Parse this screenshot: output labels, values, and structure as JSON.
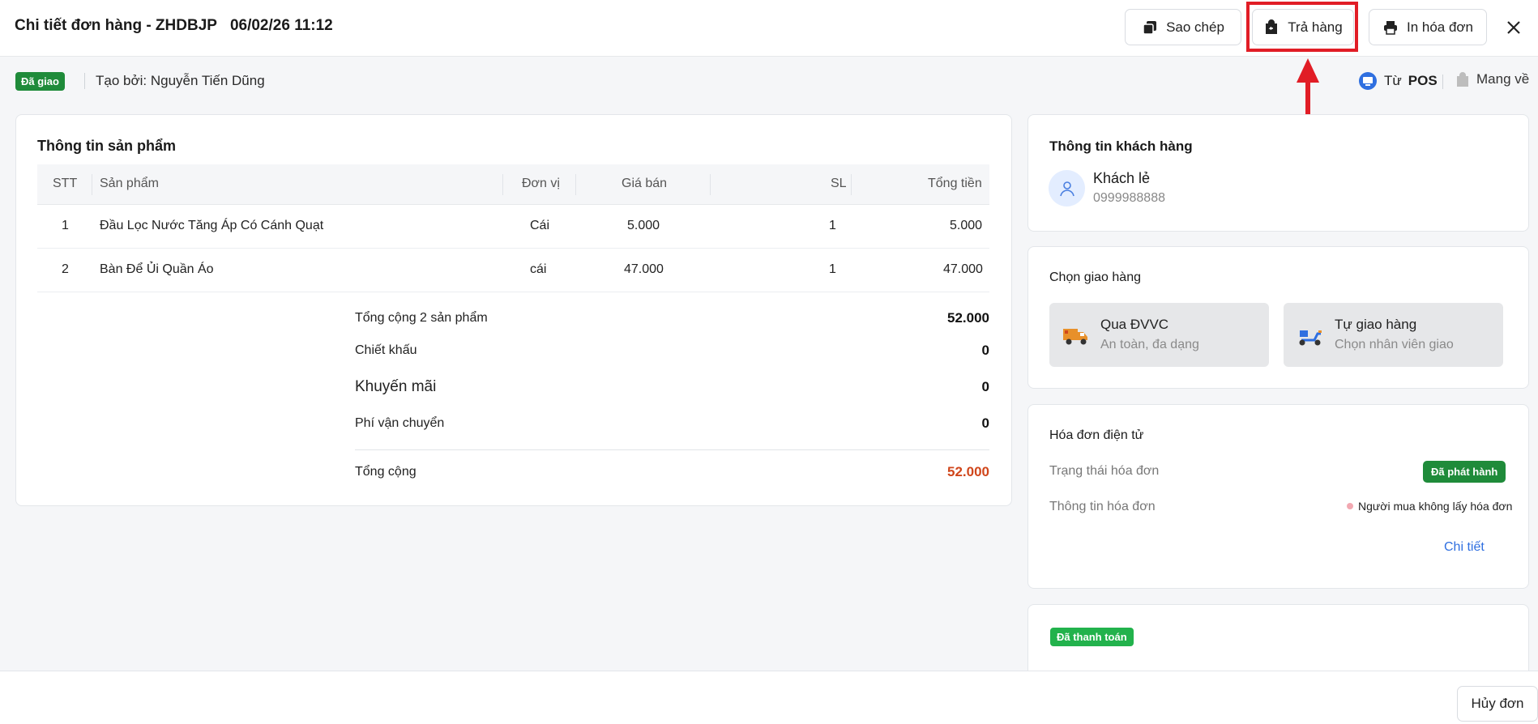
{
  "header": {
    "title": "Chi tiết đơn hàng - ZHDBJP",
    "datetime": "06/02/26 11:12",
    "copy_label": "Sao chép",
    "return_label": "Trả hàng",
    "print_label": "In hóa đơn"
  },
  "subbar": {
    "status": "Đã giao",
    "created_by": "Tạo bởi: Nguyễn Tiến Dũng",
    "source_prefix": "Từ",
    "source_name": "POS",
    "takeaway": "Mang về"
  },
  "products": {
    "title": "Thông tin sản phẩm",
    "columns": [
      "STT",
      "Sản phẩm",
      "Đơn vị",
      "Giá bán",
      "SL",
      "Tổng tiền"
    ],
    "rows": [
      {
        "stt": "1",
        "name": "Đầu Lọc Nước Tăng Áp Có Cánh Quạt",
        "unit": "Cái",
        "price": "5.000",
        "qty": "1",
        "total": "5.000"
      },
      {
        "stt": "2",
        "name": "Bàn Để Ủi Quần Áo",
        "unit": "cái",
        "price": "47.000",
        "qty": "1",
        "total": "47.000"
      }
    ],
    "summary": {
      "subtotal_label": "Tổng cộng 2 sản phẩm",
      "subtotal": "52.000",
      "discount_label": "Chiết khấu",
      "discount": "0",
      "promo_label": "Khuyến mãi",
      "promo": "0",
      "shipping_label": "Phí vận chuyển",
      "shipping": "0",
      "total_label": "Tổng cộng",
      "total": "52.000"
    }
  },
  "customer": {
    "title": "Thông tin khách hàng",
    "name": "Khách lẻ",
    "phone": "0999988888"
  },
  "delivery": {
    "title": "Chọn giao hàng",
    "options": [
      {
        "title": "Qua ĐVVC",
        "subtitle": "An toàn, đa dạng"
      },
      {
        "title": "Tự giao hàng",
        "subtitle": "Chọn nhân viên giao"
      }
    ]
  },
  "invoice": {
    "title": "Hóa đơn điện tử",
    "status_label": "Trạng thái hóa đơn",
    "status_value": "Đã phát hành",
    "info_label": "Thông tin hóa đơn",
    "info_value": "Người mua không lấy hóa đơn",
    "detail_link": "Chi tiết"
  },
  "payment": {
    "status": "Đã thanh toán"
  },
  "footer": {
    "cancel_label": "Hủy đơn"
  },
  "colors": {
    "accent_green": "#1f8b3a",
    "highlight_red": "#e11d26",
    "total_orange": "#d0461b",
    "link_blue": "#2f6fe0"
  }
}
